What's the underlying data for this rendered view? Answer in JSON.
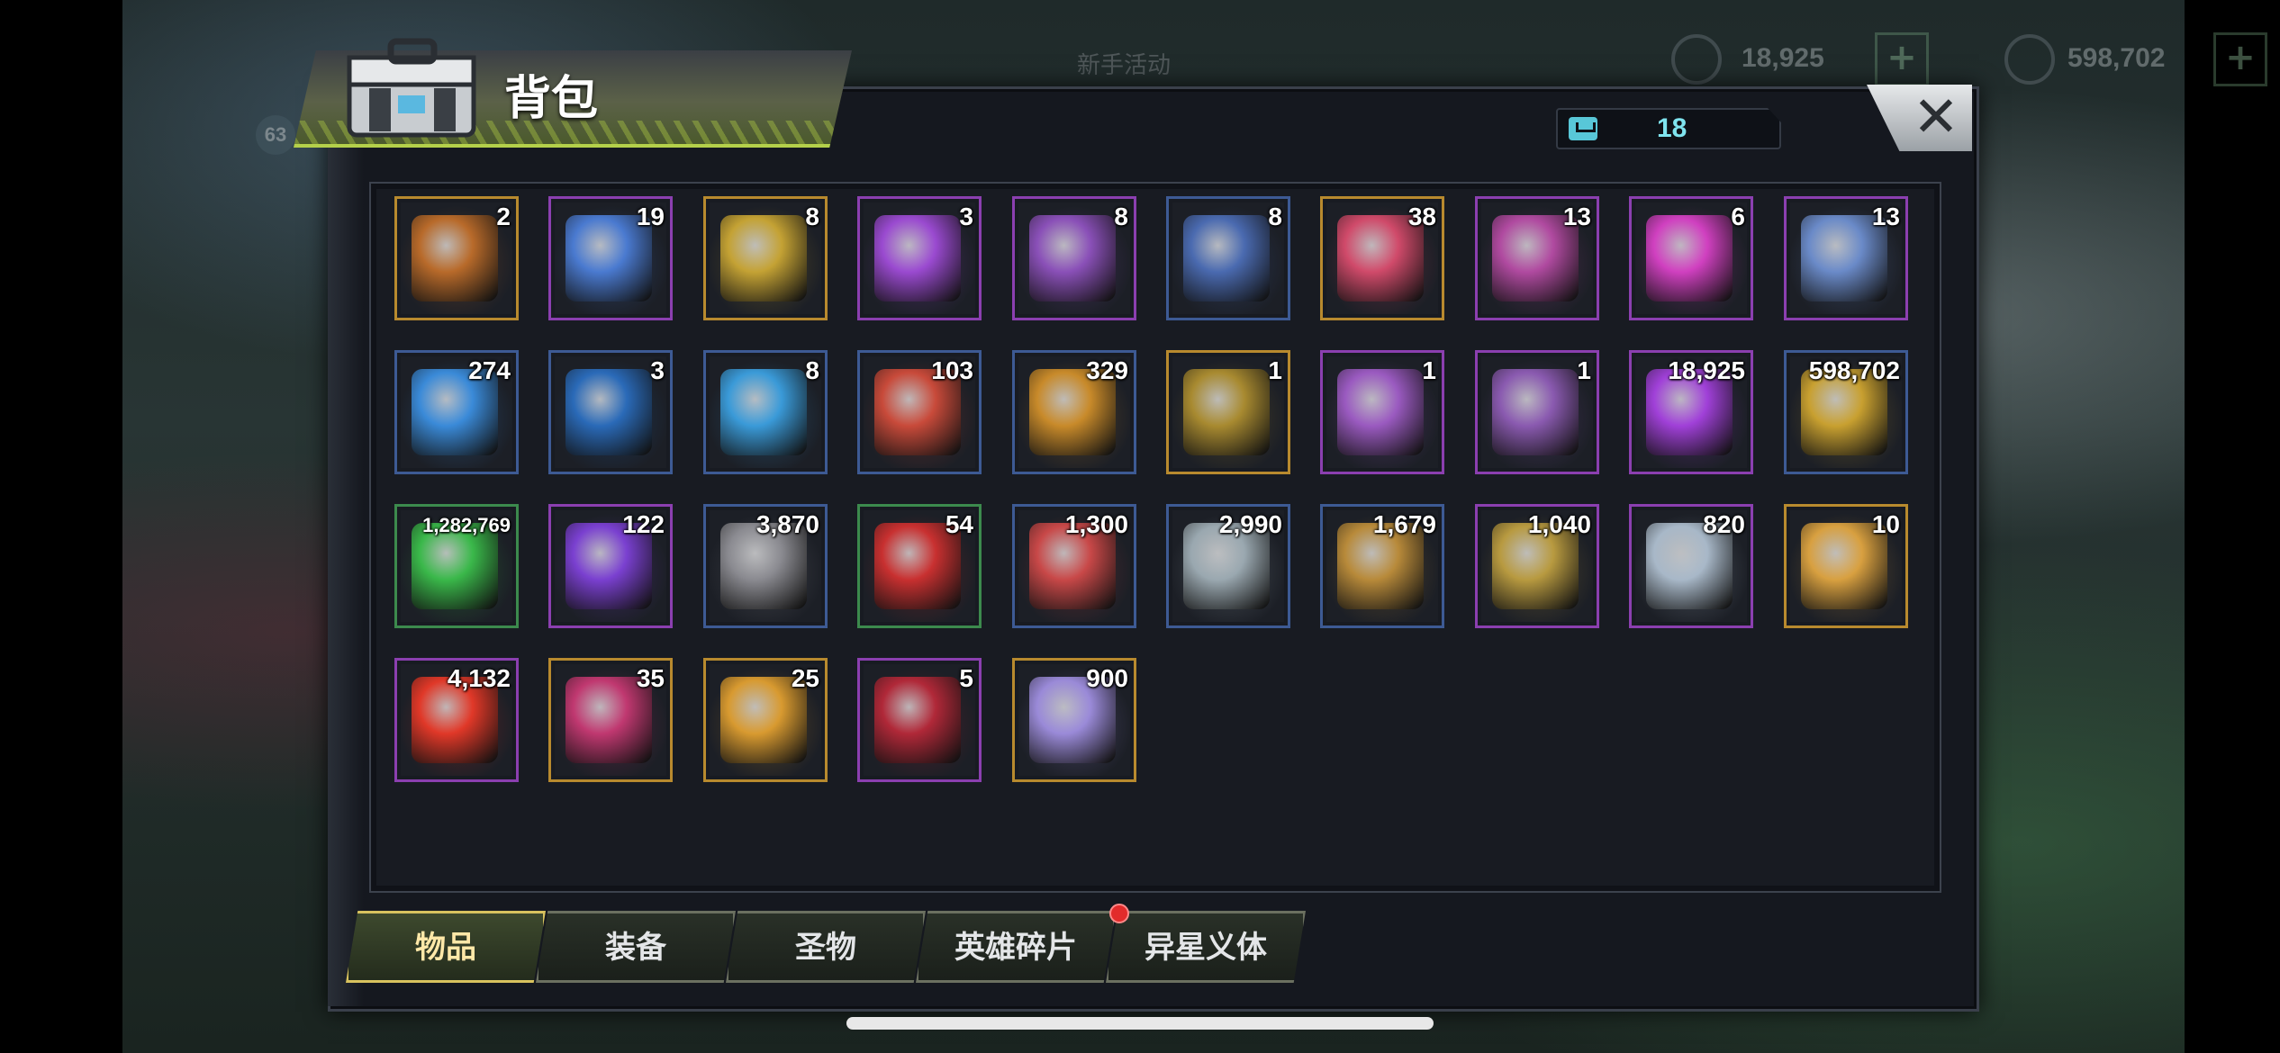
{
  "background": {
    "event_text": "新手活动",
    "level": "63",
    "resource_1": "18,925",
    "resource_2": "598,702"
  },
  "window": {
    "title": "背包",
    "close_label": "✕",
    "capacity_value": "18"
  },
  "items": [
    {
      "qty": "2",
      "icon": "supply-chest-icon",
      "rarity": "gold",
      "color": "#b86a2a"
    },
    {
      "qty": "19",
      "icon": "teleport-device-icon",
      "rarity": "purple",
      "color": "#4a7ad0"
    },
    {
      "qty": "8",
      "icon": "gold-24h-shield-card-icon",
      "rarity": "gold",
      "color": "#c4a234"
    },
    {
      "qty": "3",
      "icon": "purple-12h-card-icon",
      "rarity": "purple",
      "color": "#9a4ad0"
    },
    {
      "qty": "8",
      "icon": "purple-gold-12h-card-icon",
      "rarity": "purple",
      "color": "#8a50b8"
    },
    {
      "qty": "8",
      "icon": "blue-4h-card-icon",
      "rarity": "blue",
      "color": "#4a6ab0"
    },
    {
      "qty": "38",
      "icon": "red-bottle-cap-icon",
      "rarity": "gold",
      "color": "#d04a6a"
    },
    {
      "qty": "13",
      "icon": "film-reel-icon",
      "rarity": "purple",
      "color": "#b04aa0"
    },
    {
      "qty": "6",
      "icon": "pink-bottle-cap-icon",
      "rarity": "purple",
      "color": "#d040c0"
    },
    {
      "qty": "13",
      "icon": "police-badge-icon",
      "rarity": "purple",
      "color": "#6a8ac8"
    },
    {
      "qty": "274",
      "icon": "cinema-ticket-icon",
      "rarity": "blue",
      "color": "#3a8ad8"
    },
    {
      "qty": "3",
      "icon": "speedup-timer-icon",
      "rarity": "blue",
      "color": "#2a6ab8"
    },
    {
      "qty": "8",
      "icon": "blue-bottle-cap-icon",
      "rarity": "blue",
      "color": "#3a9ad8"
    },
    {
      "qty": "103",
      "icon": "casino-chip-icon",
      "rarity": "blue",
      "color": "#c84a3a"
    },
    {
      "qty": "329",
      "icon": "bullet-icon",
      "rarity": "blue",
      "color": "#c88a2a"
    },
    {
      "qty": "1",
      "icon": "gold-blueprint-icon",
      "rarity": "gold",
      "color": "#a88a30"
    },
    {
      "qty": "1",
      "icon": "purple-boot-blueprint-icon",
      "rarity": "purple",
      "color": "#9a5ac0"
    },
    {
      "qty": "1",
      "icon": "purple-blueprint-icon",
      "rarity": "purple",
      "color": "#8a5ab0"
    },
    {
      "qty": "18,925",
      "icon": "purple-crystal-icon",
      "rarity": "purple",
      "color": "#a040d8"
    },
    {
      "qty": "598,702",
      "icon": "gold-coins-icon",
      "rarity": "blue",
      "color": "#c8a030"
    },
    {
      "qty": "1,282,769",
      "icon": "green-battery-icon",
      "rarity": "green",
      "color": "#3ab84a",
      "small": true
    },
    {
      "qty": "122",
      "icon": "purple-orb-icon",
      "rarity": "purple",
      "color": "#7a40d0"
    },
    {
      "qty": "3,870",
      "icon": "gear-part-icon",
      "rarity": "blue",
      "color": "#8a8a90"
    },
    {
      "qty": "54",
      "icon": "red-nodes-icon",
      "rarity": "green",
      "color": "#c83030"
    },
    {
      "qty": "1,300",
      "icon": "armor-helmet-icon",
      "rarity": "blue",
      "color": "#c84848"
    },
    {
      "qty": "2,990",
      "icon": "silver-prism-icon",
      "rarity": "blue",
      "color": "#9aa8b0"
    },
    {
      "qty": "1,679",
      "icon": "gold-fist-icon",
      "rarity": "blue",
      "color": "#b88a3a"
    },
    {
      "qty": "1,040",
      "icon": "puzzle-piece-icon",
      "rarity": "purple",
      "color": "#b89a40"
    },
    {
      "qty": "820",
      "icon": "ship-badge-silver-icon",
      "rarity": "purple",
      "color": "#a8b8c8"
    },
    {
      "qty": "10",
      "icon": "ship-badge-gold-icon",
      "rarity": "gold",
      "color": "#d8a040"
    },
    {
      "qty": "4,132",
      "icon": "red-hazard-core-icon",
      "rarity": "purple",
      "color": "#e03828"
    },
    {
      "qty": "35",
      "icon": "ruby-ore-icon",
      "rarity": "gold",
      "color": "#c03870"
    },
    {
      "qty": "25",
      "icon": "gold-coin-stack-icon",
      "rarity": "gold",
      "color": "#d89a30"
    },
    {
      "qty": "5",
      "icon": "red-hex-core-icon",
      "rarity": "purple",
      "color": "#b02838"
    },
    {
      "qty": "900",
      "icon": "silver-emblem-icon",
      "rarity": "gold",
      "color": "#9a8ad8"
    }
  ],
  "tabs": [
    {
      "label": "物品",
      "active": true
    },
    {
      "label": "装备",
      "active": false
    },
    {
      "label": "圣物",
      "active": false
    },
    {
      "label": "英雄碎片",
      "active": false,
      "badge": true
    },
    {
      "label": "异星义体",
      "active": false
    }
  ]
}
